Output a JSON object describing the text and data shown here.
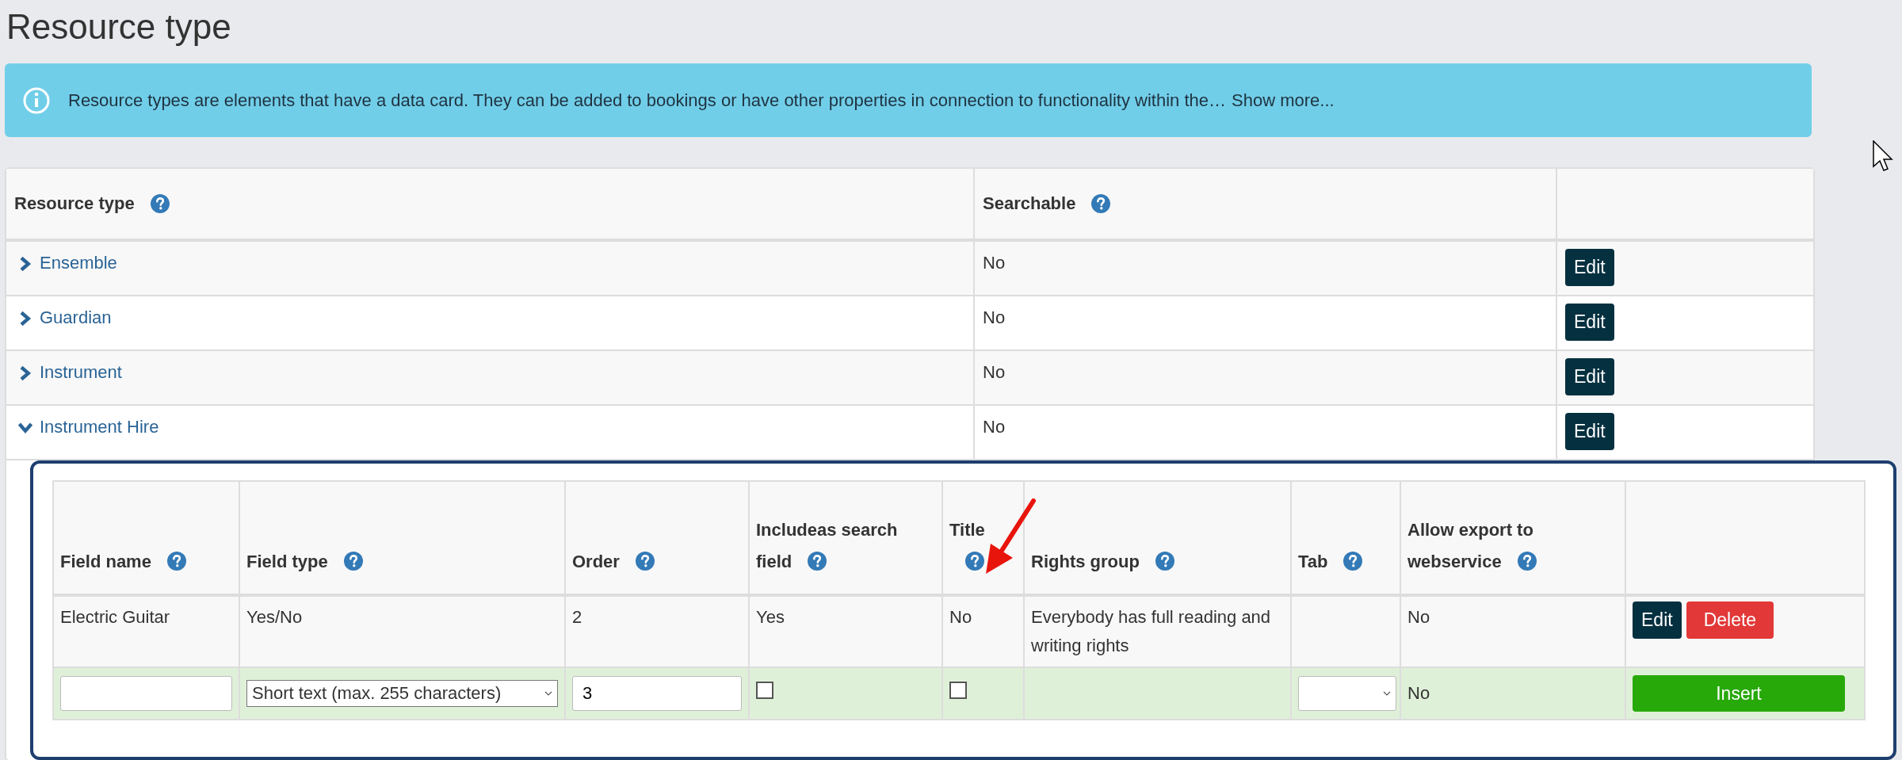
{
  "page": {
    "title": "Resource type"
  },
  "info": {
    "text": "Resource types are elements that have a data card. They can be added to bookings or have other properties in connection to functionality within the…",
    "link": "Show more..."
  },
  "table": {
    "columns": [
      {
        "label": "Resource type",
        "help": true
      },
      {
        "label": "Searchable",
        "help": true
      }
    ],
    "rows": [
      {
        "name": "Ensemble",
        "expanded": false,
        "searchable": "No",
        "action": "Edit"
      },
      {
        "name": "Guardian",
        "expanded": false,
        "searchable": "No",
        "action": "Edit"
      },
      {
        "name": "Instrument",
        "expanded": false,
        "searchable": "No",
        "action": "Edit"
      },
      {
        "name": "Instrument Hire",
        "expanded": true,
        "searchable": "No",
        "action": "Edit"
      }
    ]
  },
  "fields": {
    "columns": [
      {
        "label": "Field name",
        "help": true
      },
      {
        "label": "Field type",
        "help": true
      },
      {
        "label": "Order",
        "help": true
      },
      {
        "label": "Includeas search field",
        "help": true
      },
      {
        "label": "Title",
        "help": true
      },
      {
        "label": "Rights group",
        "help": true
      },
      {
        "label": "Tab",
        "help": true
      },
      {
        "label": "Allow export to webservice",
        "help": true
      }
    ],
    "rows": [
      {
        "cells": [
          "Electric Guitar",
          "Yes/No",
          "2",
          "Yes",
          "No",
          "Everybody has full reading and writing rights",
          "",
          "No"
        ],
        "actions": [
          {
            "label": "Edit",
            "kind": "edit"
          },
          {
            "label": "Delete",
            "kind": "delete"
          }
        ]
      }
    ],
    "insert_row": {
      "field_type": "Short text (max. 255 characters)",
      "order": "3",
      "include_search": {
        "checked": false
      },
      "title": {
        "checked": false
      },
      "allow_export": "No",
      "button": "Insert"
    }
  }
}
